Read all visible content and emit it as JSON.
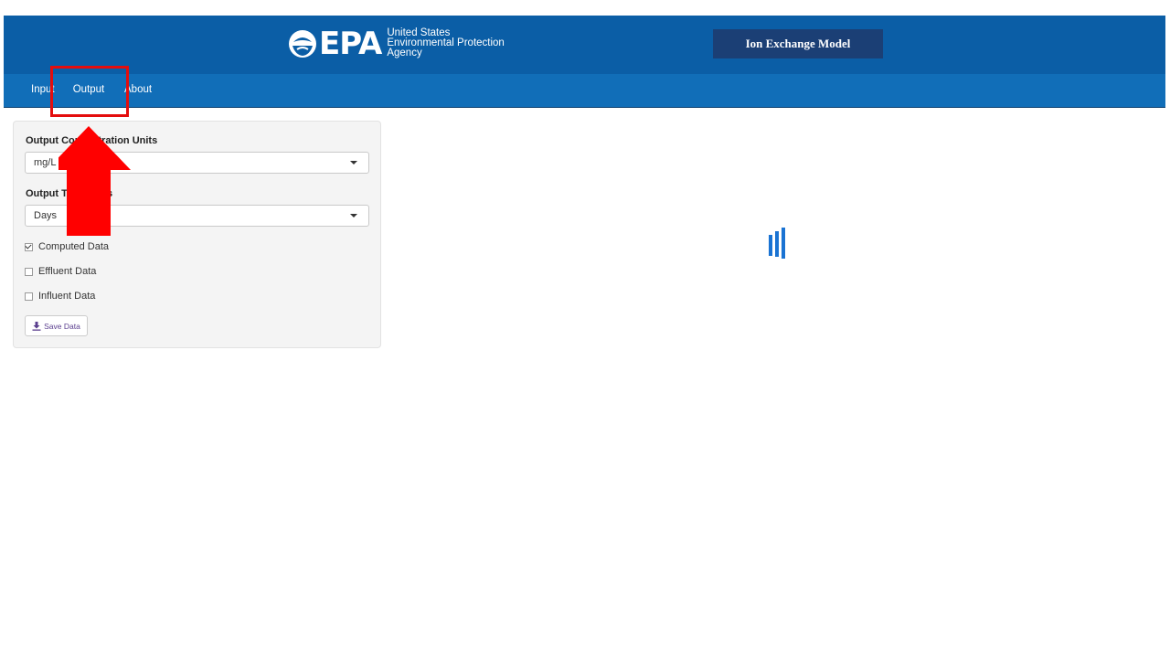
{
  "header": {
    "logo_word": "EPA",
    "logo_lines": [
      "United States",
      "Environmental Protection",
      "Agency"
    ],
    "model_title": "Ion Exchange Model"
  },
  "nav": {
    "tabs": [
      {
        "label": "Input"
      },
      {
        "label": "Output",
        "active": true
      },
      {
        "label": "About"
      }
    ]
  },
  "sidebar": {
    "conc_units_label": "Output Concentration Units",
    "conc_units_value": "mg/L",
    "time_units_label": "Output Time Units",
    "time_units_value": "Days",
    "checkboxes": [
      {
        "label": "Computed Data",
        "checked": true
      },
      {
        "label": "Effluent Data",
        "checked": false
      },
      {
        "label": "Influent Data",
        "checked": false
      }
    ],
    "save_button_label": "Save Data"
  },
  "annotation": {
    "color": "#ff0000",
    "target": "Output"
  },
  "colors": {
    "header": "#0b5ea6",
    "navbar": "#116eb8",
    "title_box": "#1b3f75",
    "spinner": "#1a73d3",
    "highlight": "#e40d0d"
  }
}
